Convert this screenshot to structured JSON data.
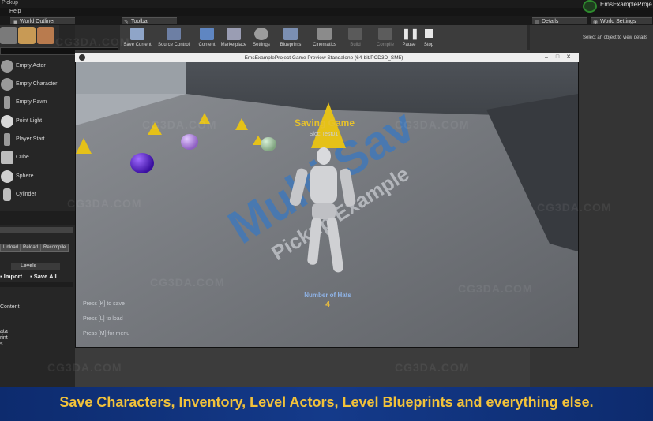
{
  "app": {
    "project_name": "EmsExampleProje",
    "menu": [
      "Help"
    ],
    "window_fragment": "Pickup"
  },
  "tabs": {
    "world_outliner": "World Outliner",
    "toolbar": "Toolbar",
    "details": "Details",
    "world_settings": "World Settings",
    "levels": "Levels"
  },
  "place_items": [
    "Empty Actor",
    "Empty Character",
    "Empty Pawn",
    "Point Light",
    "Player Start",
    "Cube",
    "Sphere",
    "Cylinder"
  ],
  "left_buttons": {
    "unload": "Unload",
    "reload": "Reload",
    "recompile": "Recompile",
    "import": "Import",
    "save_all": "Save All"
  },
  "left_text": [
    "Content",
    "ata",
    "rint",
    "s"
  ],
  "toolbar_items": [
    "Save Current",
    "Source Control",
    "Content",
    "Marketplace",
    "Settings",
    "Blueprints",
    "Cinematics",
    "Build",
    "Compile",
    "Pause",
    "Stop"
  ],
  "details": {
    "hint": "Select an object to view details"
  },
  "game": {
    "title": "EmsExampleProject Game Preview Standalone (64-bit/PCD3D_SM5)",
    "saving": "Saving Game",
    "slot": "Slot: Test01",
    "floor_title": "Multi Sav",
    "floor_sub": "Pickup Example",
    "hats_label": "Number of Hats",
    "hats_value": "4",
    "hints": [
      "Press [K] to save",
      "Press [L] to load",
      "Press [M] for menu"
    ]
  },
  "banner": "Save Characters, Inventory, Level Actors, Level Blueprints and everything else.",
  "watermark": "CG3DA.COM",
  "colors": {
    "accent": "#f2c23a",
    "banner_bg": "#143a8a",
    "hud_blue": "#8fb4e8",
    "cone": "#e5c118"
  }
}
